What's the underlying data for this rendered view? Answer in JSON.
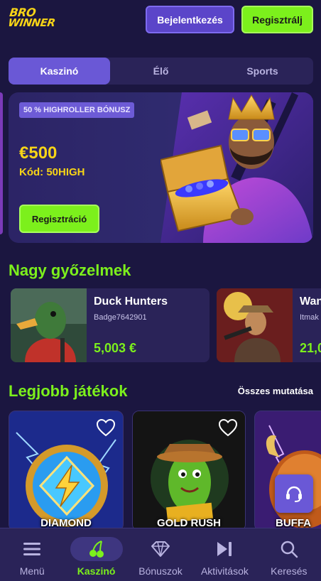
{
  "header": {
    "logo_line1": "BRO",
    "logo_line2": "WINNER",
    "login_label": "Bejelentkezés",
    "register_label": "Regisztrálj"
  },
  "tabs": [
    {
      "label": "Kaszinó",
      "active": true
    },
    {
      "label": "Élő",
      "active": false
    },
    {
      "label": "Sports",
      "active": false
    }
  ],
  "banner": {
    "badge": "50 % HIGHROLLER BÓNUSZ",
    "amount": "€500",
    "code": "Kód: 50HIGH",
    "button_label": "Regisztráció"
  },
  "big_wins": {
    "title": "Nagy győzelmek",
    "items": [
      {
        "game": "Duck Hunters",
        "user": "Badge7642901",
        "amount": "5,003 €"
      },
      {
        "game": "Wan",
        "user": "Itmak",
        "amount": "21,0"
      }
    ]
  },
  "top_games": {
    "title": "Legjobb játékok",
    "see_all": "Összes mutatása",
    "items": [
      {
        "name": "DIAMOND"
      },
      {
        "name": "GOLD RUSH"
      },
      {
        "name": "BUFFA"
      }
    ]
  },
  "bottom_nav": [
    {
      "label": "Menü",
      "icon": "menu-icon",
      "active": false
    },
    {
      "label": "Kaszinó",
      "icon": "cherry-icon",
      "active": true
    },
    {
      "label": "Bónuszok",
      "icon": "diamond-icon",
      "active": false
    },
    {
      "label": "Aktivitások",
      "icon": "play-next-icon",
      "active": false
    },
    {
      "label": "Keresés",
      "icon": "search-icon",
      "active": false
    }
  ],
  "colors": {
    "background": "#1b1640",
    "accent_green": "#7cf01c",
    "accent_purple": "#6a58d6",
    "accent_yellow": "#f7d417"
  }
}
